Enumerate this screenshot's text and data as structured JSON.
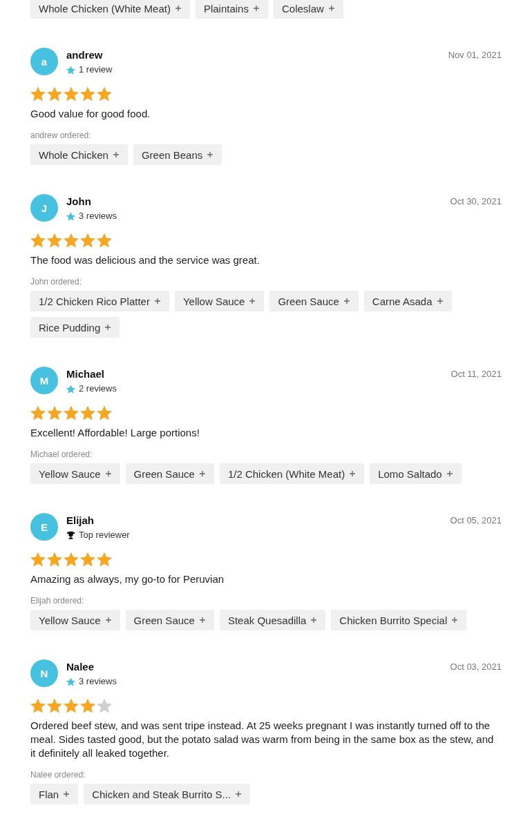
{
  "previous_order_items": [
    "Whole Chicken (White Meat)",
    "Plaintains",
    "Coleslaw"
  ],
  "reviews": [
    {
      "initial": "a",
      "name": "andrew",
      "badge": {
        "kind": "reviews",
        "text": "1 review"
      },
      "date": "Nov 01, 2021",
      "stars": 5,
      "comment": "Good value for good food.",
      "ordered_label": "andrew ordered:",
      "items": [
        "Whole Chicken",
        "Green Beans"
      ]
    },
    {
      "initial": "J",
      "name": "John",
      "badge": {
        "kind": "reviews",
        "text": "3 reviews"
      },
      "date": "Oct 30, 2021",
      "stars": 5,
      "comment": "The food was delicious and the service was great.",
      "ordered_label": "John ordered:",
      "items": [
        "1/2 Chicken Rico Platter",
        "Yellow Sauce",
        "Green Sauce",
        "Carne Asada",
        "Rice Pudding"
      ]
    },
    {
      "initial": "M",
      "name": "Michael",
      "badge": {
        "kind": "reviews",
        "text": "2 reviews"
      },
      "date": "Oct 11, 2021",
      "stars": 5,
      "comment": "Excellent! Affordable! Large portions!",
      "ordered_label": "Michael ordered:",
      "items": [
        "Yellow Sauce",
        "Green Sauce",
        "1/2 Chicken (White Meat)",
        "Lomo Saltado"
      ]
    },
    {
      "initial": "E",
      "name": "Elijah",
      "badge": {
        "kind": "top_reviewer",
        "text": "Top reviewer"
      },
      "date": "Oct 05, 2021",
      "stars": 5,
      "comment": "Amazing as always, my go-to for Peruvian",
      "ordered_label": "Elijah ordered:",
      "items": [
        "Yellow Sauce",
        "Green Sauce",
        "Steak Quesadilla",
        "Chicken Burrito Special"
      ]
    },
    {
      "initial": "N",
      "name": "Nalee",
      "badge": {
        "kind": "reviews",
        "text": "3 reviews"
      },
      "date": "Oct 03, 2021",
      "stars": 4,
      "comment": "Ordered beef stew, and was sent tripe instead. At 25 weeks pregnant I was instantly turned off to the meal. Sides tasted good, but the potato salad was warm from being in the same box as the stew, and it definitely all leaked together.",
      "ordered_label": "Nalee ordered:",
      "items": [
        "Flan",
        "Chicken and Steak Burrito S..."
      ]
    }
  ]
}
